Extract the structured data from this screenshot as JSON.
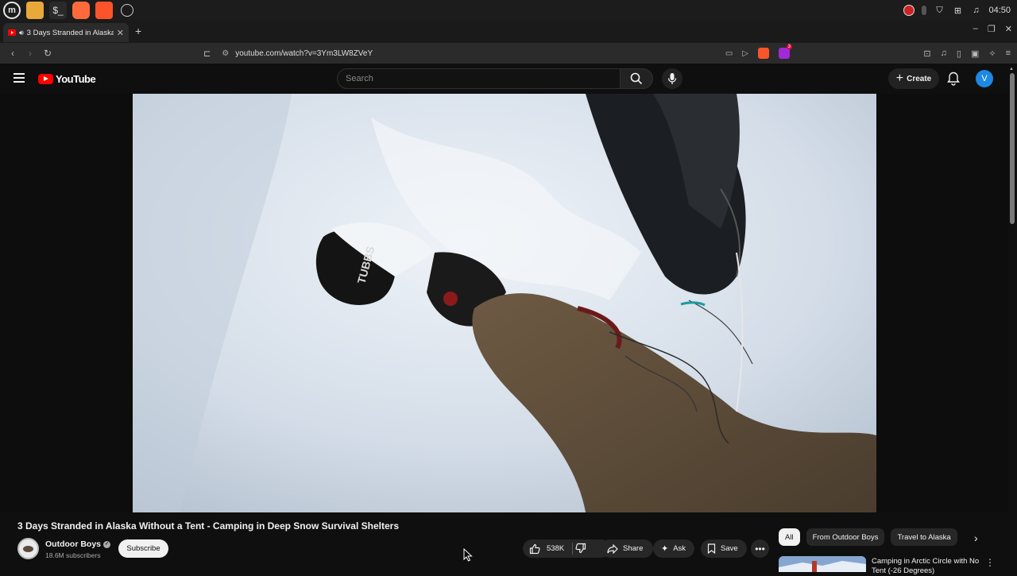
{
  "taskbar": {
    "apps": [
      "menu-app",
      "files-app",
      "terminal-app",
      "firefox-app",
      "brave-app",
      "chromium-app"
    ],
    "clock": "04:50"
  },
  "browser": {
    "tab_title": "3 Days Stranded in Alaska",
    "new_tab": "+",
    "url": "youtube.com/watch?v=3Ym3LW8ZVeY",
    "rewards_badge": "3"
  },
  "youtube": {
    "logo_text": "YouTube",
    "search_placeholder": "Search",
    "create_label": "Create",
    "avatar_letter": "V"
  },
  "video": {
    "title": "3 Days Stranded in Alaska Without a Tent - Camping in Deep Snow Survival Shelters",
    "channel_name": "Outdoor Boys",
    "subscribers": "18.6M subscribers",
    "subscribe_label": "Subscribe",
    "likes": "538K",
    "share_label": "Share",
    "ask_label": "Ask",
    "save_label": "Save",
    "hat_text": "TUBBS"
  },
  "sidebar": {
    "chips": [
      "All",
      "From Outdoor Boys",
      "Travel to Alaska"
    ],
    "recommendation": {
      "title": "Camping in Arctic Circle with No Tent (-26 Degrees)"
    }
  },
  "colors": {
    "background": "#0f0f0f",
    "brand_red": "#ff0000",
    "avatar_blue": "#1e88e5"
  }
}
